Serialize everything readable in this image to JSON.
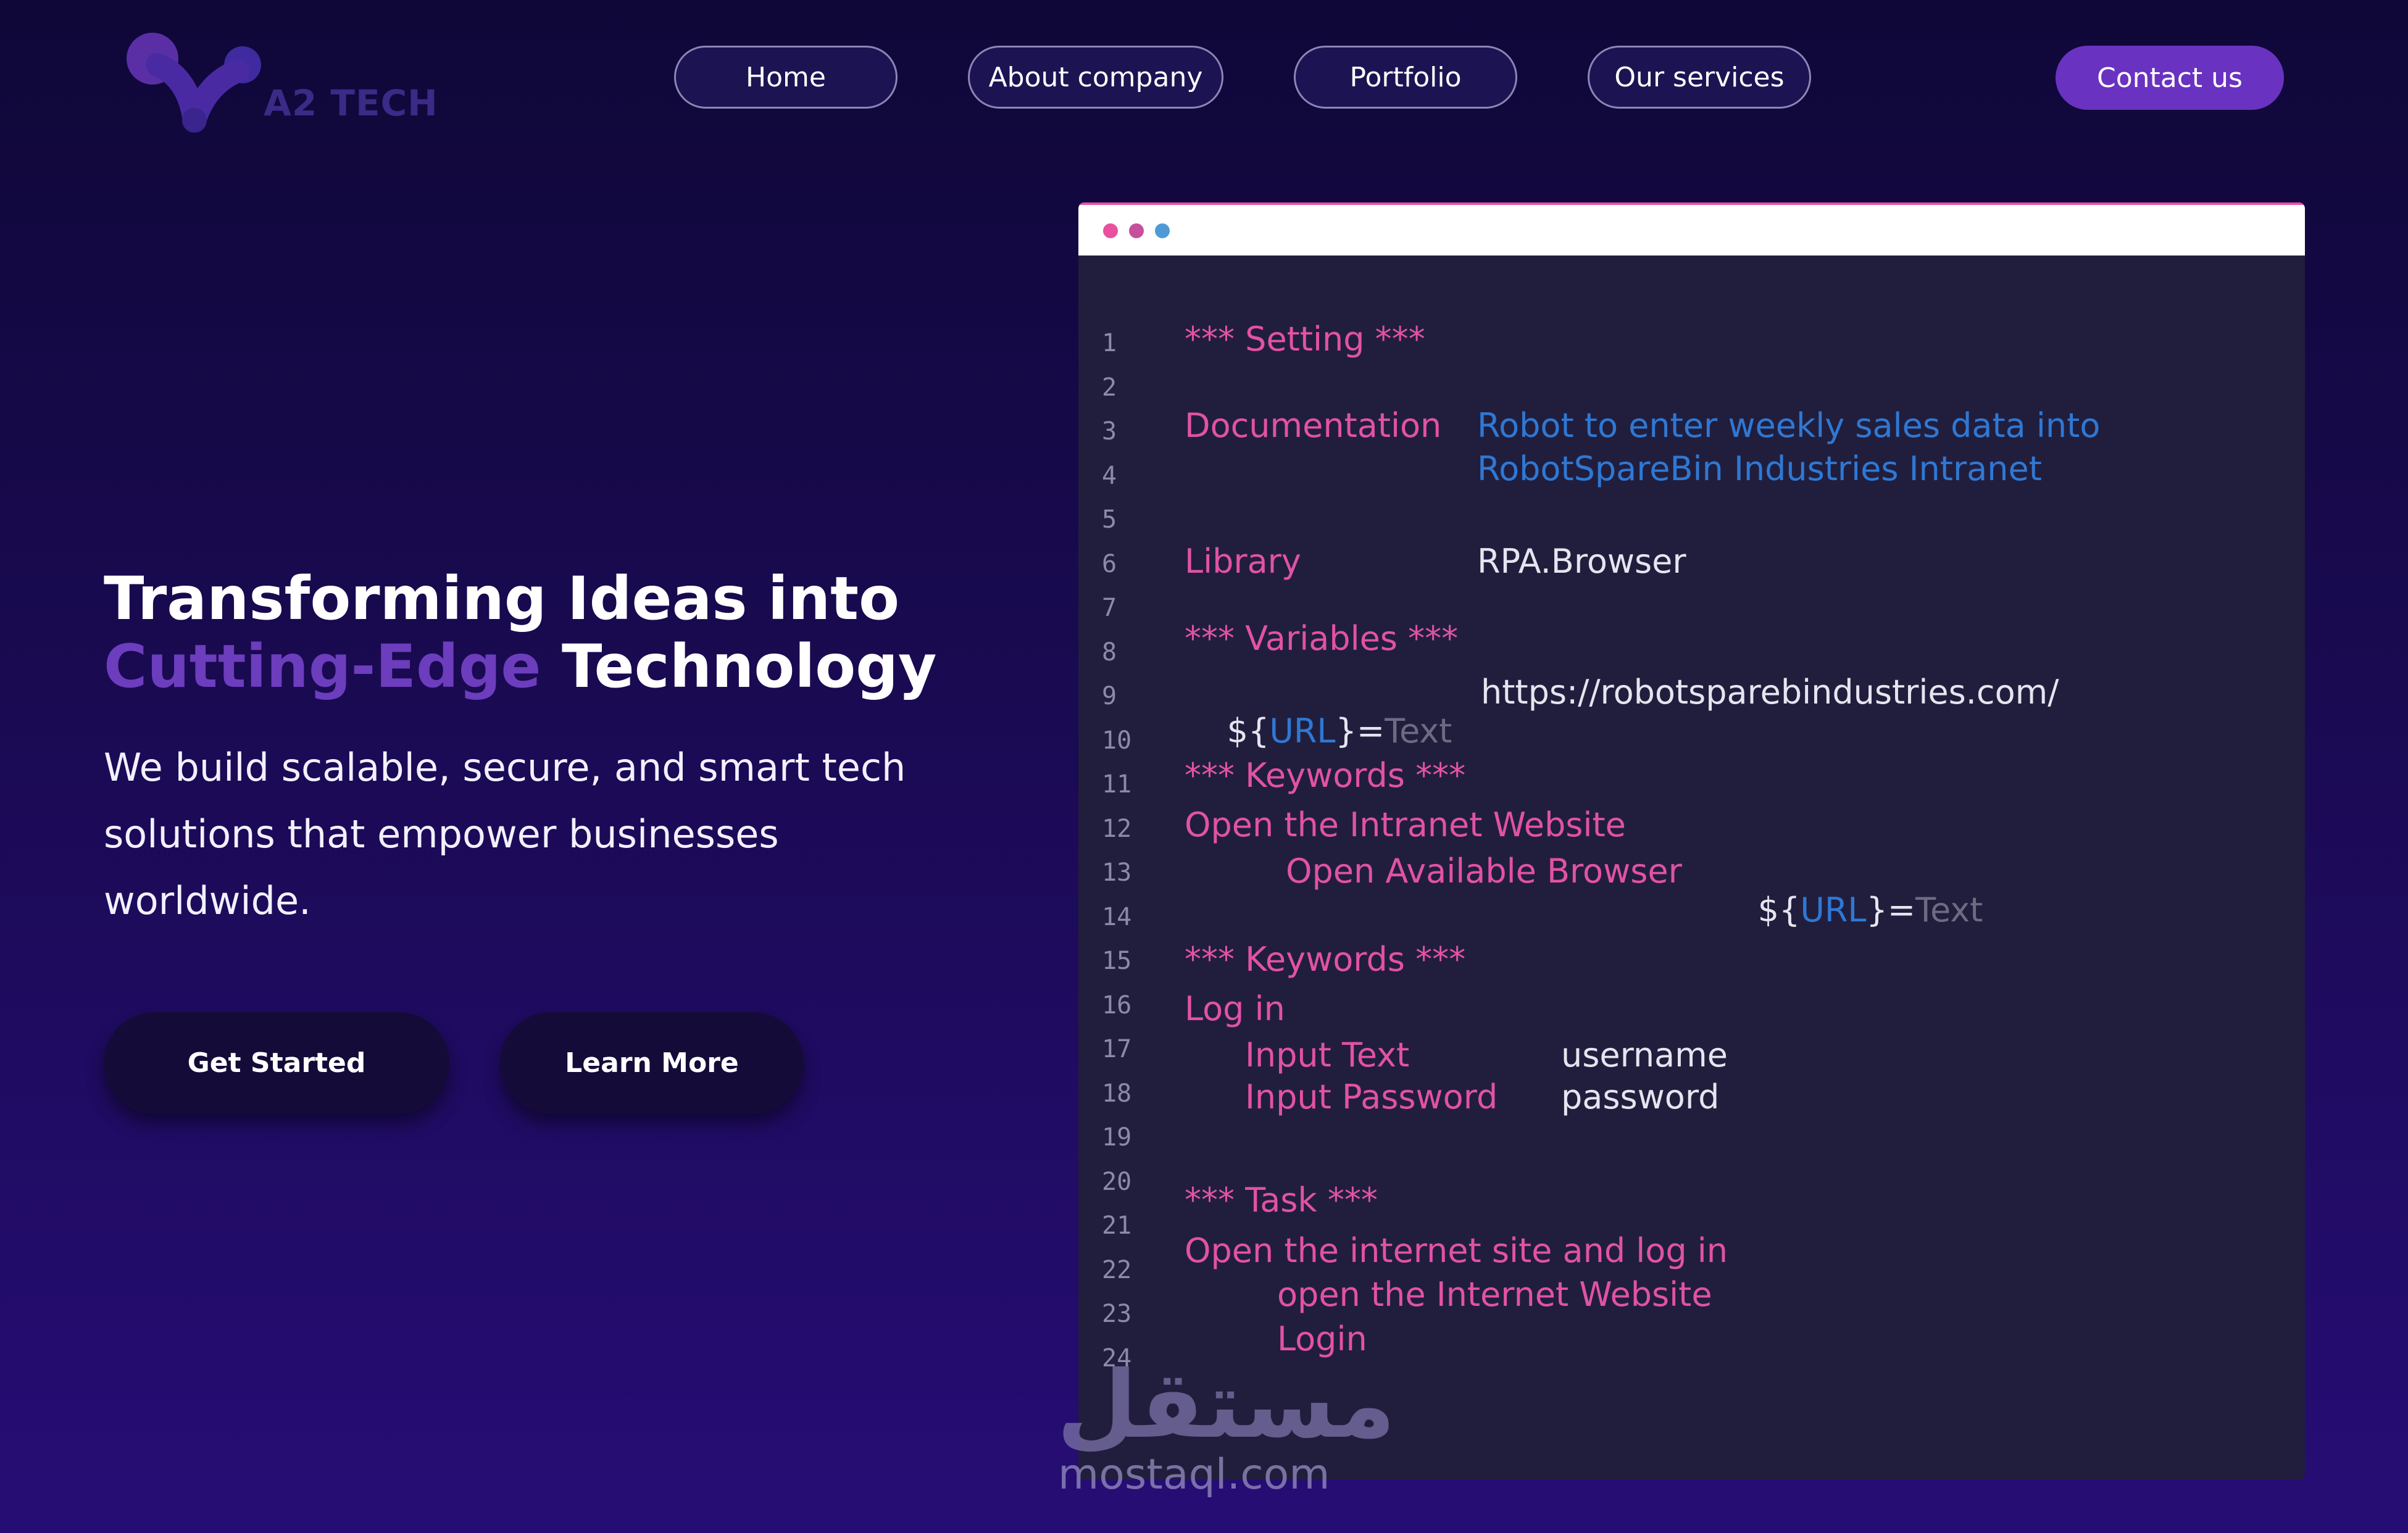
{
  "brand": {
    "logo_text": "A2 TECH"
  },
  "nav": {
    "items": [
      "Home",
      "About company",
      "Portfolio",
      "Our services"
    ],
    "contact_label": "Contact us"
  },
  "hero": {
    "title_line1": "Transforming Ideas into",
    "title_accent": "Cutting-Edge",
    "title_rest": " Technology",
    "subtitle_line1": "We build scalable, secure, and smart tech",
    "subtitle_line2": "solutions that empower businesses",
    "subtitle_line3": "worldwide.",
    "primary_cta": "Get Started",
    "secondary_cta": "Learn More"
  },
  "colors": {
    "accent": "#6c3dbd",
    "keyword_pink": "#e152a5",
    "link_blue": "#2f78d4",
    "muted_text": "#6d6a82",
    "value_text": "#e6e4f0"
  },
  "editor": {
    "window_dots": [
      "#e9509f",
      "#c64f9e",
      "#4f9ad6"
    ],
    "line_numbers": [
      "1",
      "2",
      "3",
      "4",
      "5",
      "6",
      "7",
      "8",
      "9",
      "10",
      "11",
      "12",
      "13",
      "14",
      "15",
      "16",
      "17",
      "18",
      "19",
      "20",
      "21",
      "22",
      "23",
      "24"
    ],
    "code": {
      "l1": "*** Setting ***",
      "l3_key": "Documentation",
      "l3_val": "Robot to enter weekly sales data into",
      "l4_val": "RobotSpareBin Industries Intranet",
      "l6_key": "Library",
      "l6_val": "RPA.Browser",
      "l8": "*** Variables ***",
      "l9_dollar": "${",
      "l9_var": "URL",
      "l9_close": "}=",
      "l9_type": "Text",
      "l9_val": "https://robotsparebindustries.com/",
      "l11": "*** Keywords ***",
      "l12": "Open the Intranet Website",
      "l13_kw": "Open Available Browser",
      "l13_dollar": "${",
      "l13_var": "URL",
      "l13_close": "}=",
      "l13_type": "Text",
      "l15": "*** Keywords ***",
      "l16": "Log in",
      "l17_kw": "Input Text",
      "l17_val": "username",
      "l18_kw": "Input Password",
      "l18_val": "password",
      "l20": "*** Task ***",
      "l21": "Open the internet site and log in",
      "l22": "open the Internet Website",
      "l23": "Login"
    }
  },
  "watermark": {
    "glyph": "مستقل",
    "url": "mostaql.com"
  }
}
